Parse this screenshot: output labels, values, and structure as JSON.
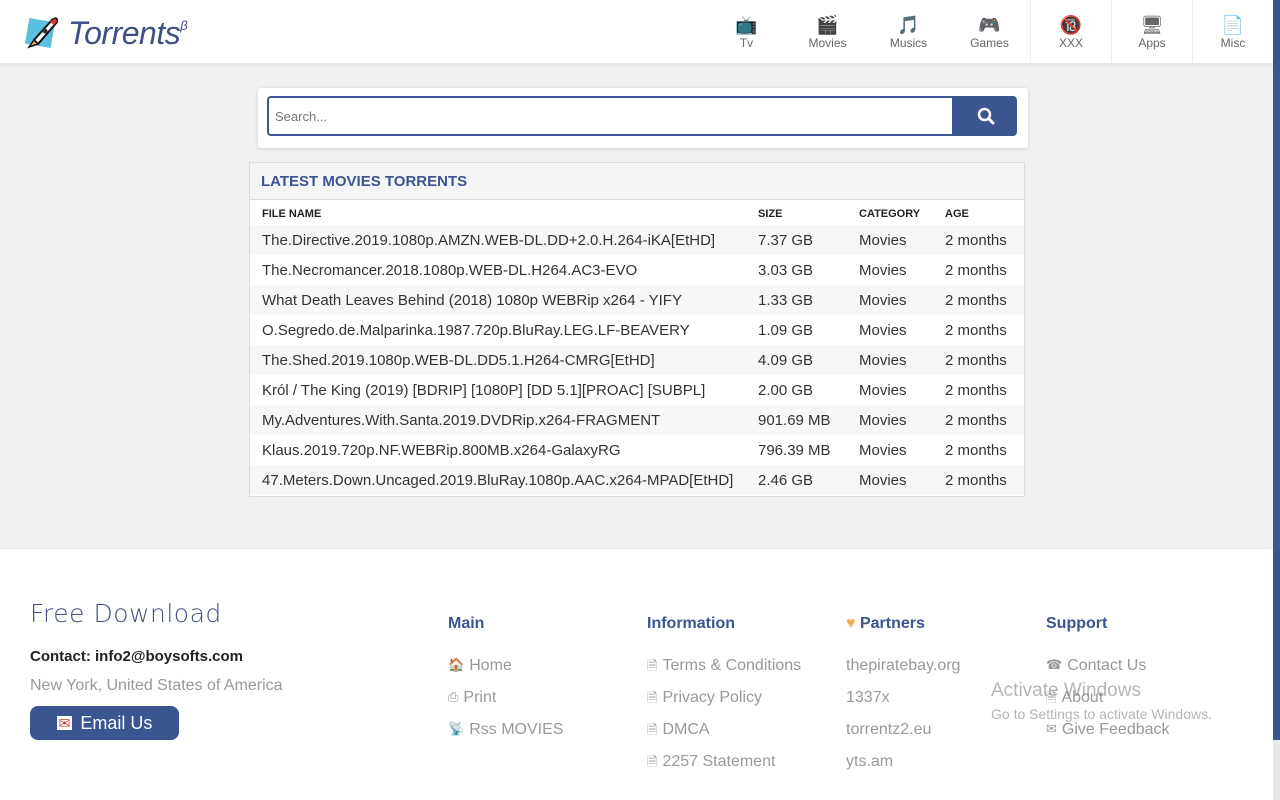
{
  "header": {
    "logo": "Torrents",
    "logo_sup": "β",
    "nav": [
      {
        "label": "Tv",
        "icon": "📺"
      },
      {
        "label": "Movies",
        "icon": "🎬"
      },
      {
        "label": "Musics",
        "icon": "🎵"
      },
      {
        "label": "Games",
        "icon": "🎮"
      },
      {
        "label": "XXX",
        "icon": "🔞"
      },
      {
        "label": "Apps",
        "icon": "🖥"
      },
      {
        "label": "Misc",
        "icon": "📄"
      }
    ]
  },
  "search": {
    "placeholder": "Search..."
  },
  "panel": {
    "title": "LATEST MOVIES TORRENTS",
    "columns": [
      "FILE NAME",
      "SIZE",
      "CATEGORY",
      "AGE"
    ],
    "rows": [
      [
        "The.Directive.2019.1080p.AMZN.WEB-DL.DD+2.0.H.264-iKA[EtHD]",
        "7.37 GB",
        "Movies",
        "2 months"
      ],
      [
        "The.Necromancer.2018.1080p.WEB-DL.H264.AC3-EVO",
        "3.03 GB",
        "Movies",
        "2 months"
      ],
      [
        "What Death Leaves Behind (2018) 1080p WEBRip x264 - YIFY",
        "1.33 GB",
        "Movies",
        "2 months"
      ],
      [
        "O.Segredo.de.Malparinka.1987.720p.BluRay.LEG.LF-BEAVERY",
        "1.09 GB",
        "Movies",
        "2 months"
      ],
      [
        "The.Shed.2019.1080p.WEB-DL.DD5.1.H264-CMRG[EtHD]",
        "4.09 GB",
        "Movies",
        "2 months"
      ],
      [
        "Król / The King (2019) [BDRIP] [1080P] [DD 5.1][PROAC] [SUBPL]",
        "2.00 GB",
        "Movies",
        "2 months"
      ],
      [
        "My.Adventures.With.Santa.2019.DVDRip.x264-FRAGMENT",
        "901.69 MB",
        "Movies",
        "2 months"
      ],
      [
        "Klaus.2019.720p.NF.WEBRip.800MB.x264-GalaxyRG",
        "796.39 MB",
        "Movies",
        "2 months"
      ],
      [
        "47.Meters.Down.Uncaged.2019.BluRay.1080p.AAC.x264-MPAD[EtHD]",
        "2.46 GB",
        "Movies",
        "2 months"
      ]
    ]
  },
  "footer": {
    "title": "Free Download",
    "contact": "Contact: info2@boysofts.com",
    "address": "New York, United States of America",
    "email_btn": "Email Us",
    "main": {
      "title": "Main",
      "links": [
        {
          "icon": "🏠",
          "label": "Home"
        },
        {
          "icon": "⎙",
          "label": "Print"
        },
        {
          "icon": "📡",
          "label": "Rss MOVIES"
        }
      ]
    },
    "information": {
      "title": "Information",
      "links": [
        {
          "icon": "🗎",
          "label": "Terms & Conditions"
        },
        {
          "icon": "🗎",
          "label": "Privacy Policy"
        },
        {
          "icon": "🗎",
          "label": "DMCA"
        },
        {
          "icon": "🗎",
          "label": "2257 Statement"
        }
      ]
    },
    "partners": {
      "title": "Partners",
      "links": [
        {
          "label": "thepiratebay.org"
        },
        {
          "label": "1337x"
        },
        {
          "label": "torrentz2.eu"
        },
        {
          "label": "yts.am"
        }
      ]
    },
    "support": {
      "title": "Support",
      "links": [
        {
          "icon": "☎",
          "label": "Contact Us"
        },
        {
          "icon": "🗎",
          "label": "About"
        },
        {
          "icon": "✉",
          "label": "Give Feedback"
        }
      ]
    }
  },
  "watermark": {
    "line1": "Activate Windows",
    "line2": "Go to Settings to activate Windows."
  }
}
